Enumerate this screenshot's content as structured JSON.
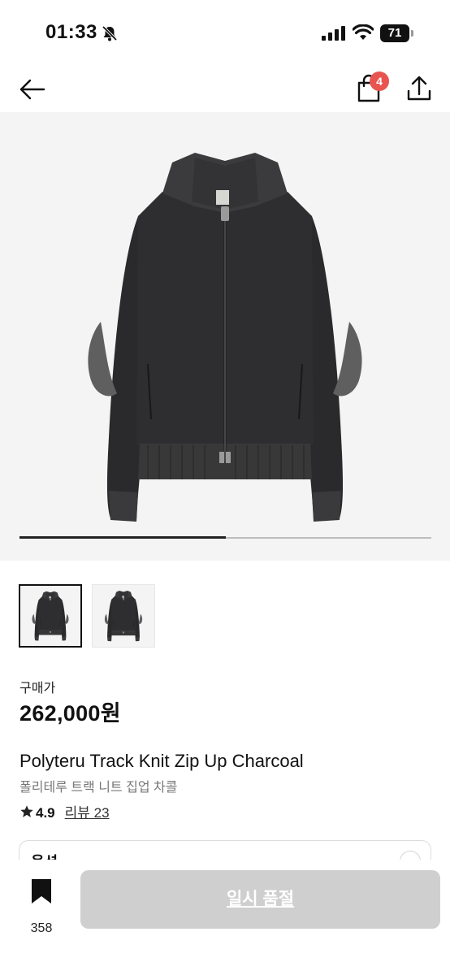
{
  "status_bar": {
    "time": "01:33",
    "battery": "71"
  },
  "nav": {
    "cart_count": "4"
  },
  "gallery": {
    "progress": 0.5,
    "thumbnail_count": 2,
    "selected_index": 0
  },
  "product": {
    "price_label": "구매가",
    "price": "262,000원",
    "name_en": "Polyteru Track Knit Zip Up Charcoal",
    "name_ko": "폴리테루 트랙 니트 집업 차콜",
    "rating": "4.9",
    "review_text": "리뷰 23"
  },
  "option": {
    "label": "옵션"
  },
  "bottom_bar": {
    "wish_count": "358",
    "action_label": "일시 품절"
  },
  "colors": {
    "badge": "#e8544f",
    "button_disabled": "#cfcfcf",
    "jacket": "#2b2b2d"
  }
}
